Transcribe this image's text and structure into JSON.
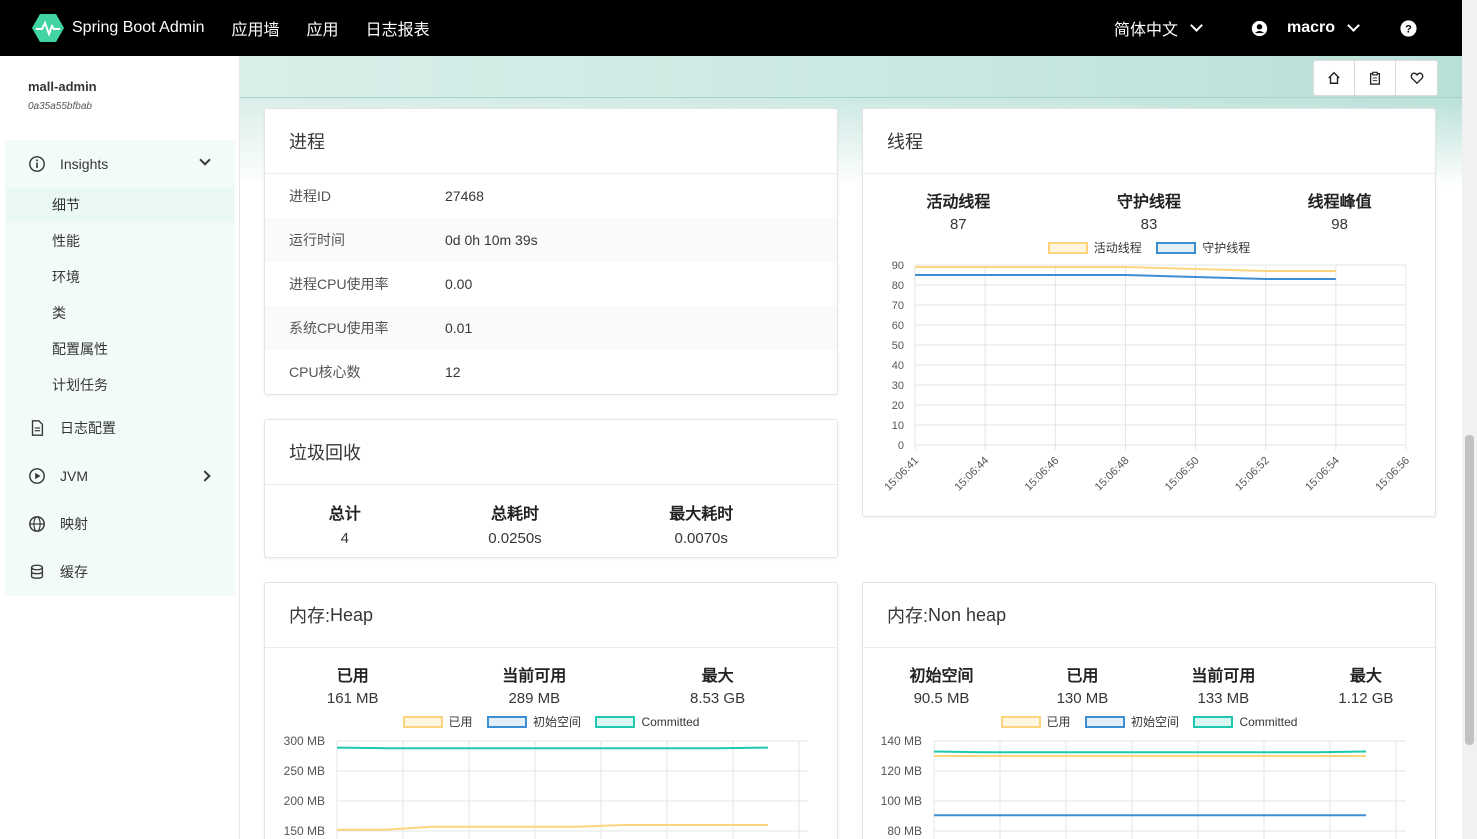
{
  "navbar": {
    "brand": "Spring Boot Admin",
    "links": [
      "应用墙",
      "应用",
      "日志报表"
    ],
    "language": "简体中文",
    "user": "macro"
  },
  "sidebar": {
    "app_name": "mall-admin",
    "app_id": "0a35a55bfbab",
    "insights_label": "Insights",
    "insights_items": [
      "细节",
      "性能",
      "环境",
      "类",
      "配置属性",
      "计划任务"
    ],
    "log_config": "日志配置",
    "jvm": "JVM",
    "mappings": "映射",
    "cache": "缓存"
  },
  "process": {
    "title": "进程",
    "rows": [
      {
        "key": "进程ID",
        "value": "27468"
      },
      {
        "key": "运行时间",
        "value": "0d 0h 10m 39s"
      },
      {
        "key": "进程CPU使用率",
        "value": "0.00"
      },
      {
        "key": "系统CPU使用率",
        "value": "0.01"
      },
      {
        "key": "CPU核心数",
        "value": "12"
      }
    ]
  },
  "gc": {
    "title": "垃圾回收",
    "stats": [
      {
        "label": "总计",
        "value": "4"
      },
      {
        "label": "总耗时",
        "value": "0.0250s"
      },
      {
        "label": "最大耗时",
        "value": "0.0070s"
      }
    ]
  },
  "threads": {
    "title": "线程",
    "stats": [
      {
        "label": "活动线程",
        "value": "87"
      },
      {
        "label": "守护线程",
        "value": "83"
      },
      {
        "label": "线程峰值",
        "value": "98"
      }
    ]
  },
  "heap": {
    "title_prefix": "内存: ",
    "title_name": "Heap",
    "stats": [
      {
        "label": "已用",
        "value": "161 MB"
      },
      {
        "label": "当前可用",
        "value": "289 MB"
      },
      {
        "label": "最大",
        "value": "8.53 GB"
      }
    ]
  },
  "nonheap": {
    "title_prefix": "内存: ",
    "title_name": "Non heap",
    "stats": [
      {
        "label": "初始空间",
        "value": "90.5 MB"
      },
      {
        "label": "已用",
        "value": "130 MB"
      },
      {
        "label": "当前可用",
        "value": "133 MB"
      },
      {
        "label": "最大",
        "value": "1.12 GB"
      }
    ]
  },
  "colors": {
    "yellow": "#ffd47f",
    "blue": "#3d8fd1",
    "teal": "#1ec8b0",
    "brand": "#42d3a5"
  },
  "chart_data": [
    {
      "type": "line",
      "x": [
        "15:06:41",
        "15:06:44",
        "15:06:46",
        "15:06:48",
        "15:06:50",
        "15:06:52",
        "15:06:54",
        "15:06:56"
      ],
      "ylim": [
        0,
        90
      ],
      "yticks": [
        0,
        10,
        20,
        30,
        40,
        50,
        60,
        70,
        80,
        90
      ],
      "series": [
        {
          "name": "活动线程",
          "color": "#ffd47f",
          "values": [
            89,
            89,
            89,
            89,
            88,
            87,
            87
          ]
        },
        {
          "name": "守护线程",
          "color": "#3d8fd1",
          "values": [
            85,
            85,
            85,
            85,
            84,
            83,
            83
          ]
        }
      ]
    },
    {
      "type": "line",
      "ylim": [
        150,
        300
      ],
      "ytick_labels": [
        "300 MB",
        "250 MB",
        "200 MB",
        "150 MB"
      ],
      "series": [
        {
          "name": "已用",
          "color": "#ffd47f",
          "values": [
            152,
            152,
            157,
            157,
            157,
            157,
            160,
            160,
            160,
            160
          ]
        },
        {
          "name": "初始空间",
          "color": "#3d8fd1",
          "values": []
        },
        {
          "name": "Committed",
          "color": "#1ec8b0",
          "values": [
            289,
            288,
            288,
            288,
            288,
            288,
            288,
            288,
            288,
            289
          ]
        }
      ]
    },
    {
      "type": "line",
      "ylim": [
        80,
        140
      ],
      "ytick_labels": [
        "140 MB",
        "120 MB",
        "100 MB",
        "80 MB"
      ],
      "series": [
        {
          "name": "已用",
          "color": "#ffd47f",
          "values": [
            130,
            130,
            130,
            130,
            130,
            130,
            130,
            130,
            130,
            130
          ]
        },
        {
          "name": "初始空间",
          "color": "#3d8fd1",
          "values": [
            90.5,
            90.5,
            90.5,
            90.5,
            90.5,
            90.5,
            90.5,
            90.5,
            90.5,
            90.5
          ]
        },
        {
          "name": "Committed",
          "color": "#1ec8b0",
          "values": [
            133,
            132.5,
            132.5,
            132.5,
            132.5,
            132.5,
            132.5,
            132.5,
            132.5,
            133
          ]
        }
      ]
    }
  ]
}
